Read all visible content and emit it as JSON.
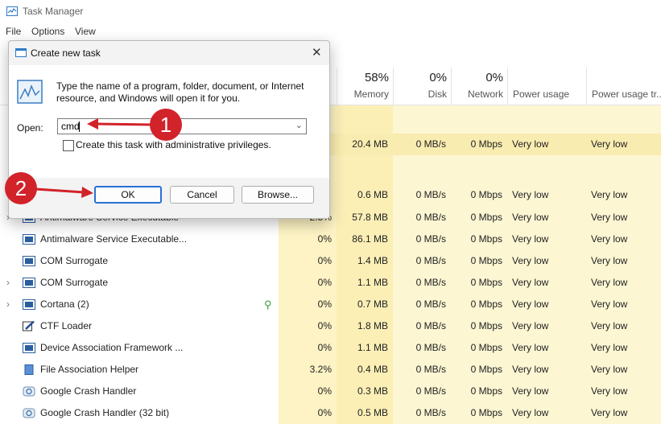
{
  "window": {
    "title": "Task Manager"
  },
  "menu": [
    "File",
    "Options",
    "View"
  ],
  "columns": {
    "cpu": {
      "pct": "",
      "label": ""
    },
    "memory": {
      "pct": "58%",
      "label": "Memory"
    },
    "disk": {
      "pct": "0%",
      "label": "Disk"
    },
    "network": {
      "pct": "0%",
      "label": "Network"
    },
    "power": {
      "label": "Power usage"
    },
    "power_trend": {
      "label": "Power usage tr..."
    }
  },
  "partial_rows": [
    {
      "mem": "20.4 MB",
      "disk": "0 MB/s",
      "net": "0 Mbps",
      "pu": "Very low",
      "put": "Very low"
    },
    {
      "mem": "0.6 MB",
      "disk": "0 MB/s",
      "net": "0 Mbps",
      "pu": "Very low",
      "put": "Very low"
    }
  ],
  "processes": [
    {
      "name": "Antimalware Service Executable",
      "expand": "›",
      "cpu": "2.5%",
      "mem": "57.8 MB",
      "disk": "0 MB/s",
      "net": "0 Mbps",
      "pu": "Very low",
      "put": "Very low",
      "icon": "service-icon"
    },
    {
      "name": "Antimalware Service Executable...",
      "expand": "",
      "cpu": "0%",
      "mem": "86.1 MB",
      "disk": "0 MB/s",
      "net": "0 Mbps",
      "pu": "Very low",
      "put": "Very low",
      "icon": "service-icon"
    },
    {
      "name": "COM Surrogate",
      "expand": "",
      "cpu": "0%",
      "mem": "1.4 MB",
      "disk": "0 MB/s",
      "net": "0 Mbps",
      "pu": "Very low",
      "put": "Very low",
      "icon": "window-icon"
    },
    {
      "name": "COM Surrogate",
      "expand": "›",
      "cpu": "0%",
      "mem": "1.1 MB",
      "disk": "0 MB/s",
      "net": "0 Mbps",
      "pu": "Very low",
      "put": "Very low",
      "icon": "window-icon"
    },
    {
      "name": "Cortana (2)",
      "expand": "›",
      "cpu": "0%",
      "mem": "0.7 MB",
      "disk": "0 MB/s",
      "net": "0 Mbps",
      "pu": "Very low",
      "put": "Very low",
      "icon": "window-icon",
      "status": "suspended-leaf-icon"
    },
    {
      "name": "CTF Loader",
      "expand": "",
      "cpu": "0%",
      "mem": "1.8 MB",
      "disk": "0 MB/s",
      "net": "0 Mbps",
      "pu": "Very low",
      "put": "Very low",
      "icon": "pen-icon"
    },
    {
      "name": "Device Association Framework ...",
      "expand": "",
      "cpu": "0%",
      "mem": "1.1 MB",
      "disk": "0 MB/s",
      "net": "0 Mbps",
      "pu": "Very low",
      "put": "Very low",
      "icon": "window-icon"
    },
    {
      "name": "File Association Helper",
      "expand": "",
      "cpu": "3.2%",
      "mem": "0.4 MB",
      "disk": "0 MB/s",
      "net": "0 Mbps",
      "pu": "Very low",
      "put": "Very low",
      "icon": "file-icon"
    },
    {
      "name": "Google Crash Handler",
      "expand": "",
      "cpu": "0%",
      "mem": "0.3 MB",
      "disk": "0 MB/s",
      "net": "0 Mbps",
      "pu": "Very low",
      "put": "Very low",
      "icon": "google-update-icon"
    },
    {
      "name": "Google Crash Handler (32 bit)",
      "expand": "",
      "cpu": "0%",
      "mem": "0.5 MB",
      "disk": "0 MB/s",
      "net": "0 Mbps",
      "pu": "Very low",
      "put": "Very low",
      "icon": "google-update-icon"
    }
  ],
  "dialog": {
    "title": "Create new task",
    "description": "Type the name of a program, folder, document, or Internet resource, and Windows will open it for you.",
    "open_label": "Open:",
    "open_value": "cmd",
    "admin_checkbox_label": "Create this task with administrative privileges.",
    "ok_label": "OK",
    "cancel_label": "Cancel",
    "browse_label": "Browse..."
  },
  "annotations": {
    "step1": "1",
    "step2": "2"
  },
  "colors": {
    "cpu_fill": "#fdf3c4",
    "mem_fill": "#fbefb6",
    "col_fill": "#fdf6d3",
    "highlight_row": "#f9ecb0",
    "annotation_red": "#d2222a",
    "ok_border": "#2a6fd6"
  }
}
